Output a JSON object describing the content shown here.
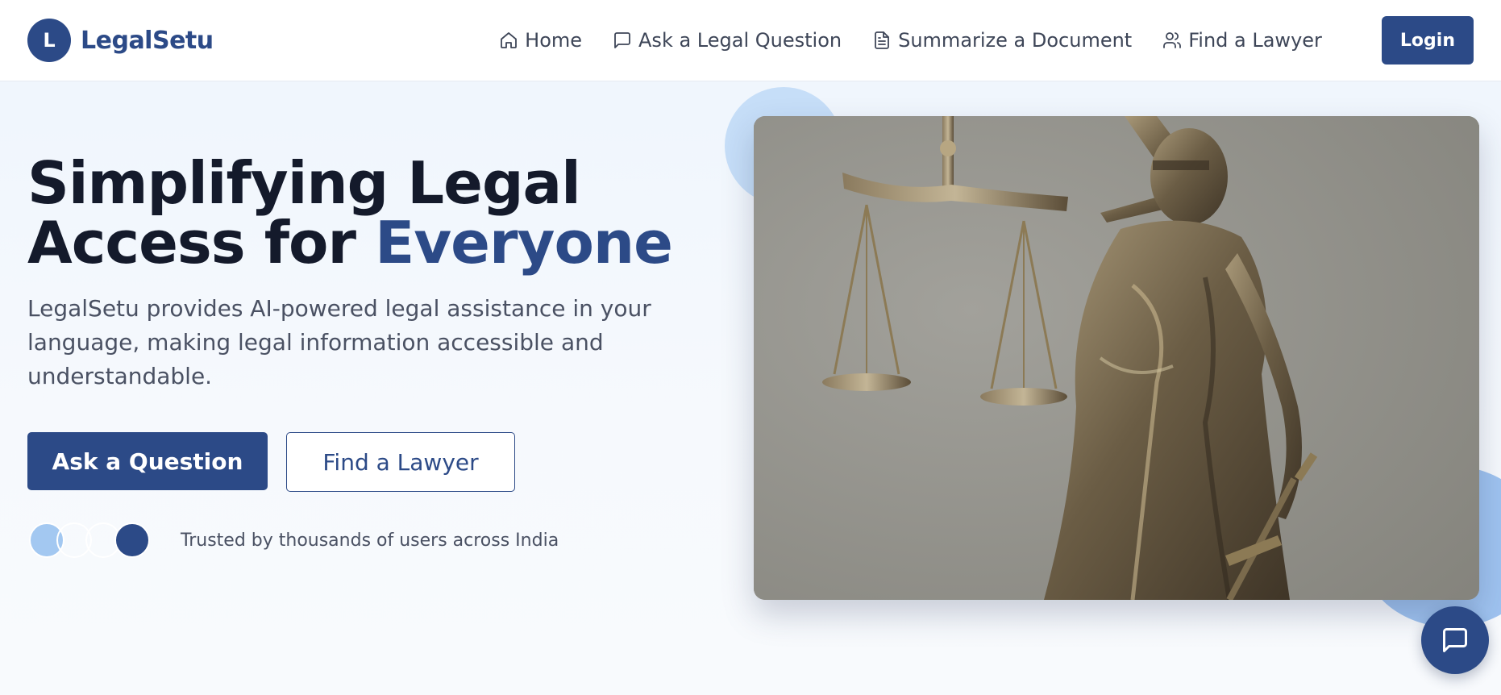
{
  "brand": {
    "mark": "L",
    "name": "LegalSetu"
  },
  "nav": {
    "items": [
      {
        "label": "Home",
        "icon": "home-icon"
      },
      {
        "label": "Ask a Legal Question",
        "icon": "message-square-icon"
      },
      {
        "label": "Summarize a Document",
        "icon": "file-text-icon"
      },
      {
        "label": "Find a Lawyer",
        "icon": "users-icon"
      }
    ],
    "login_label": "Login"
  },
  "hero": {
    "title_line1": "Simplifying Legal",
    "title_line2_prefix": "Access for ",
    "title_line2_accent": "Everyone",
    "subtitle": "LegalSetu provides AI-powered legal assistance in your language, making legal information accessible and understandable.",
    "primary_cta": "Ask a Question",
    "secondary_cta": "Find a Lawyer",
    "trust_text": "Trusted by thousands of users across India",
    "image_subject": "lady-justice-statue"
  },
  "chat_widget": {
    "icon": "message-square-icon"
  },
  "colors": {
    "brand": "#2c4a87",
    "heading": "#141a2b",
    "body_text": "#4a5163",
    "blob_light": "#c6def8",
    "blob_mid": "#9fc3f0",
    "avatar_light": "#a3c8f1"
  }
}
